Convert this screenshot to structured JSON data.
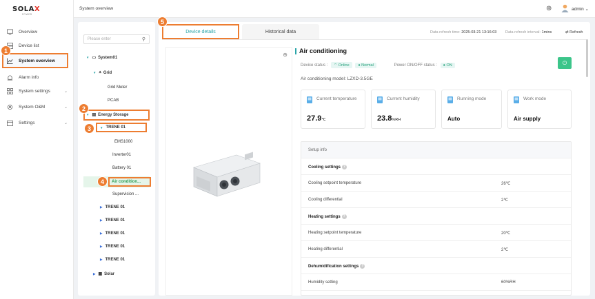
{
  "logo": {
    "brand_pre": "SOLA",
    "brand_x": "X",
    "sub": "POWER"
  },
  "nav": {
    "items": [
      {
        "label": "Overview"
      },
      {
        "label": "Device list"
      },
      {
        "label": "System overview"
      },
      {
        "label": "Alarm info"
      },
      {
        "label": "System settings"
      },
      {
        "label": "System O&M"
      },
      {
        "label": "Settings"
      }
    ]
  },
  "topbar": {
    "breadcrumb": "System overview",
    "user": "admin",
    "user_chevron": "⌄"
  },
  "tree": {
    "search_placeholder": "Please enter",
    "nodes": {
      "system": "System01",
      "grid": "Grid",
      "grid_meter": "Grid Meter",
      "pcab": "PCAB",
      "energy_storage": "Energy Storage",
      "trene": "TRENE 01",
      "ems": "EMS1000",
      "inverter": "Inverter01",
      "battery": "Battery 01",
      "air": "Air condition...",
      "supervision": "Supervision ...",
      "trene2": "TRENE 01",
      "trene3": "TRENE 01",
      "trene4": "TRENE 01",
      "trene5": "TRENE 01",
      "trene6": "TRENE 01",
      "solar": "Solar"
    }
  },
  "main": {
    "tabs": {
      "device_details": "Device details",
      "historical_data": "Historical data"
    },
    "refresh_time_label": "Data refresh time:",
    "refresh_time_value": "2025-03-21 13:16:03",
    "refresh_interval_label": "Data refresh interval:",
    "refresh_interval_value": "1mins",
    "refresh_button": "Refresh",
    "title": "Air conditioning",
    "device_status_label": "Device status :",
    "device_status_online": "Online",
    "device_status_normal": "Normal",
    "power_status_label": "Power ON/OFF status :",
    "power_status_value": "ON",
    "model_label": "Air conditioning model:",
    "model_value": "LZXD-3.5GE",
    "cards": {
      "temp_label": "Current temperature",
      "temp_value": "27.9",
      "temp_unit": "℃",
      "humidity_label": "Current humidity",
      "humidity_value": "23.8",
      "humidity_unit": "%RH",
      "running_label": "Running mode",
      "running_value": "Auto",
      "work_label": "Work mode",
      "work_value": "Air supply"
    },
    "setup": {
      "header": "Setup info",
      "cooling_settings": "Cooling settings",
      "cooling_setpoint_label": "Cooling setpoint temperature",
      "cooling_setpoint_value": "26℃",
      "cooling_diff_label": "Cooling differential",
      "cooling_diff_value": "2℃",
      "heating_settings": "Heating settings",
      "heating_setpoint_label": "Heating setpoint temperature",
      "heating_setpoint_value": "20℃",
      "heating_diff_label": "Heating differential",
      "heating_diff_value": "2℃",
      "dehum_settings": "Dehumidification settings",
      "humidity_setting_label": "Humidity setting",
      "humidity_setting_value": "60%RH"
    }
  },
  "badges": [
    "1",
    "2",
    "3",
    "4",
    "5"
  ],
  "colors": {
    "accent": "#2aa5a9",
    "highlight": "#ed7d31",
    "power_button": "#3cc58a",
    "online": "#25a07a"
  }
}
